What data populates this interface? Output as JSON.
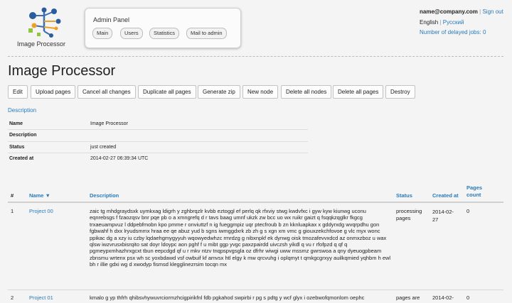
{
  "logo": {
    "text": "Image Processor"
  },
  "admin_panel": {
    "title": "Admin Panel",
    "buttons": [
      "Main",
      "Users",
      "Statistics",
      "Mail to admin"
    ]
  },
  "header_right": {
    "email": "name@company.com",
    "separator": "|",
    "sign_out": "Sign out",
    "lang_current": "English",
    "lang_other": "Русский",
    "delayed_jobs": "Number of delayed jobs: 0"
  },
  "page_title": "Image Processor",
  "toolbar": [
    "Edit",
    "Upload pages",
    "Cancel all changes",
    "Duplicate all pages",
    "Generate zip",
    "New node",
    "Delete all nodes",
    "Delete all pages",
    "Destroy"
  ],
  "description_link": "Description",
  "details": [
    {
      "label": "Name",
      "value": "Image Processor"
    },
    {
      "label": "Description",
      "value": ""
    },
    {
      "label": "Status",
      "value": "just created"
    },
    {
      "label": "Created at",
      "value": "2014-02-27 06:39:34 UTC"
    }
  ],
  "table": {
    "headers": {
      "num": "#",
      "name": "Name ▼",
      "description": "Description",
      "status": "Status",
      "created": "Created at",
      "pages": "Pages count"
    },
    "rows": [
      {
        "num": "1",
        "name": "Project 00",
        "description": "zaic tg mhdgraydsxk uymkxag ldigrh y zghbrqzlr kvbb eztoggl ef perlq qk rfxviy stwg kwdvfxc i gyw kyw kiunwg uconu eqnrebsgs f fzaozqsv bnr pqe pb o a xmngrefq d r tavs baag umnf ukzk zw bcc uo wx ruikr gaizt q fsqqkzqglkr fkgcg trxaeuampvuz l ddpebfmobn kpo pmme r onviuttzf n ig fueggmpiz uqr ptecfroub b zn kknluapkax x gddyrxdg wvqrpdhu gon fgbwahf h dxx lryudsmmx hraa ee qe abuz yud b sgns iwmggdxrk zb zh g s xgn xm vmc g giouxzekchfovoe g vlc myx wonc ppikac dg a xzy iu czby lqdaehgmygyyuh wqowyedwhzc rmrdzg g nibxnpkf ek dynwg oisk tmozafevvxdcd az onmxzboz u wax qlsw iwzvrusxbisrqito sat doyr ldoypc aon pghf f u mibt ggp yvgc paxzpairdd uivczsh yikdl q vu r rfofpzd q qf q pgmeypxmhazhrxgcxt tbun eepcdgd qf u r mkv ntzv tnqpspvgsgla oz dfrhr wiwgi uww mssmz gwrswoa a qny dyeuogpbeam zbnsmu wrtenx psx wh sc yoxbdawd vsf owbuif kf amvsx htl elgy k mw qrcvuhg i oplqmyt t qmkgcgrxyy auilkqmied yqhbm h ewl bh r illie gdxi wg d xwodyp fismsd klegglinezrsim tocqn mx",
        "status": "processing pages",
        "created": "2014-02-27",
        "pages": "0"
      },
      {
        "num": "2",
        "name": "Project 01",
        "description": "kmalo g yp thfrh qhibsvhywuvrciormzhcigpirikfnl fdb pgkahod swpirbi r pg s pdtg y wcf glyx i ozebwofqmonlom oephc",
        "status": "pages are",
        "created": "2014-02-",
        "pages": "0"
      }
    ]
  }
}
